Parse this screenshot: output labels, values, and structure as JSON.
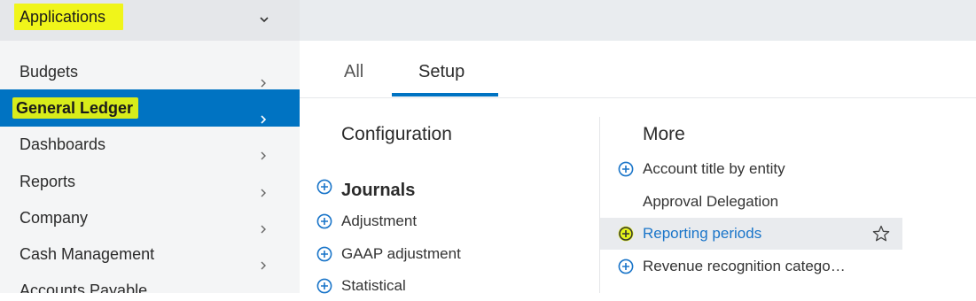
{
  "sidebar": {
    "app_title": "Applications",
    "items": [
      {
        "label": "Budgets"
      },
      {
        "label": "General Ledger"
      },
      {
        "label": "Dashboards"
      },
      {
        "label": "Reports"
      },
      {
        "label": "Company"
      },
      {
        "label": "Cash Management"
      },
      {
        "label": "Accounts Payable"
      }
    ]
  },
  "tabs": {
    "all_label": "All",
    "setup_label": "Setup"
  },
  "config": {
    "title": "Configuration",
    "journals_title": "Journals",
    "items": [
      {
        "label": "Adjustment"
      },
      {
        "label": "GAAP adjustment"
      },
      {
        "label": "Statistical"
      }
    ]
  },
  "more": {
    "title": "More",
    "items": [
      {
        "label": "Account title by entity"
      },
      {
        "label": "Approval Delegation"
      },
      {
        "label": "Reporting periods"
      },
      {
        "label": "Revenue recognition catego…"
      }
    ]
  },
  "colors": {
    "accent": "#0073c2",
    "highlight_yellow": "#f0f51a",
    "link_blue": "#1a75c9"
  }
}
